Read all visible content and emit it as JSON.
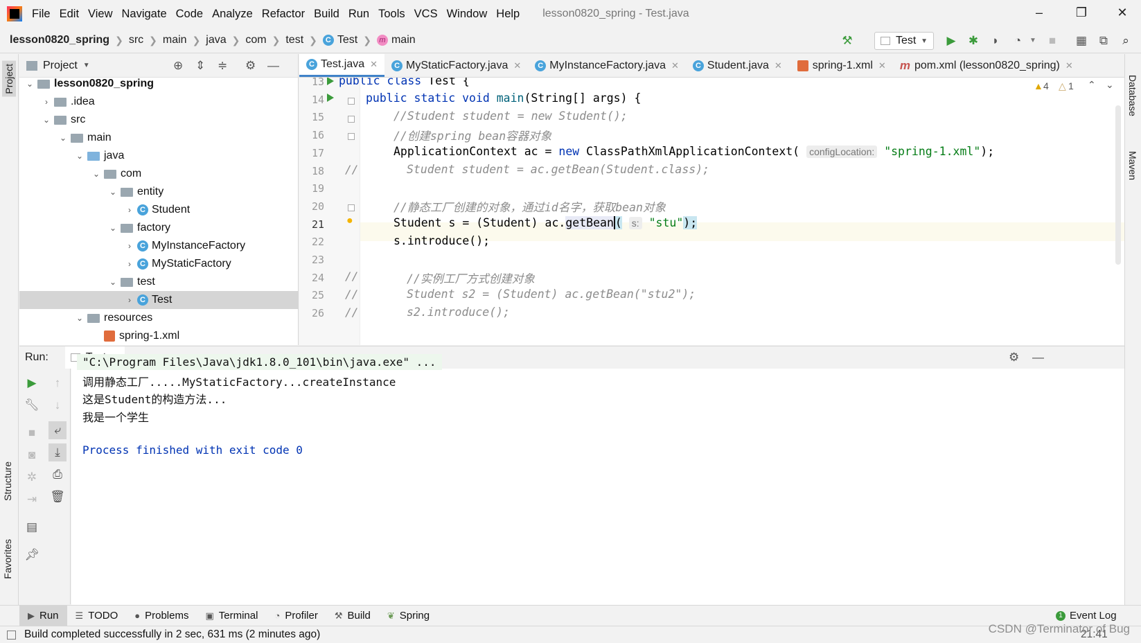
{
  "menubar": {
    "items": [
      "File",
      "Edit",
      "View",
      "Navigate",
      "Code",
      "Analyze",
      "Refactor",
      "Build",
      "Run",
      "Tools",
      "VCS",
      "Window",
      "Help"
    ],
    "window_title": "lesson0820_spring - Test.java",
    "controls": {
      "minimize": "–",
      "restore": "❐",
      "close": "✕"
    }
  },
  "breadcrumb": [
    "lesson0820_spring",
    "src",
    "main",
    "java",
    "com",
    "test",
    "Test",
    "main"
  ],
  "toolbar": {
    "run_config": "Test"
  },
  "project_panel": {
    "title": "Project",
    "tree": [
      {
        "label": "lesson0820_spring",
        "depth": 0,
        "expanded": true,
        "type": "module"
      },
      {
        "label": ".idea",
        "depth": 1,
        "expanded": false,
        "type": "folder"
      },
      {
        "label": "src",
        "depth": 1,
        "expanded": true,
        "type": "folder"
      },
      {
        "label": "main",
        "depth": 2,
        "expanded": true,
        "type": "folder"
      },
      {
        "label": "java",
        "depth": 3,
        "expanded": true,
        "type": "source-folder"
      },
      {
        "label": "com",
        "depth": 4,
        "expanded": true,
        "type": "package"
      },
      {
        "label": "entity",
        "depth": 5,
        "expanded": true,
        "type": "package"
      },
      {
        "label": "Student",
        "depth": 6,
        "expanded": false,
        "type": "class"
      },
      {
        "label": "factory",
        "depth": 5,
        "expanded": true,
        "type": "package"
      },
      {
        "label": "MyInstanceFactory",
        "depth": 6,
        "expanded": false,
        "type": "class"
      },
      {
        "label": "MyStaticFactory",
        "depth": 6,
        "expanded": false,
        "type": "class"
      },
      {
        "label": "test",
        "depth": 5,
        "expanded": true,
        "type": "package"
      },
      {
        "label": "Test",
        "depth": 6,
        "expanded": false,
        "type": "class",
        "selected": true
      },
      {
        "label": "resources",
        "depth": 3,
        "expanded": true,
        "type": "resources"
      },
      {
        "label": "spring-1.xml",
        "depth": 4,
        "expanded": false,
        "type": "xml"
      }
    ]
  },
  "editor_tabs": [
    {
      "label": "Test.java",
      "icon": "class-icon",
      "active": true
    },
    {
      "label": "MyStaticFactory.java",
      "icon": "class-icon",
      "active": false
    },
    {
      "label": "MyInstanceFactory.java",
      "icon": "class-icon",
      "active": false
    },
    {
      "label": "Student.java",
      "icon": "class-icon",
      "active": false
    },
    {
      "label": "spring-1.xml",
      "icon": "xml-icon",
      "active": false
    },
    {
      "label": "pom.xml (lesson0820_spring)",
      "icon": "maven-icon",
      "active": false
    }
  ],
  "inspections": {
    "warnings": "4",
    "weak_warnings": "1"
  },
  "code": {
    "line_numbers": [
      "13",
      "14",
      "15",
      "16",
      "17",
      "18",
      "19",
      "20",
      "21",
      "22",
      "23",
      "24",
      "25",
      "26"
    ],
    "l13_kw": "public class ",
    "l13_rest": "Test {",
    "l14_kw": "public static void ",
    "l14_name": "main",
    "l14_rest": "(String[] args) {",
    "l15": "//Student student = new Student();",
    "l16": "//创建spring bean容器对象",
    "l17_a": "ApplicationContext ac = ",
    "l17_kw": "new ",
    "l17_b": "ClassPathXmlApplicationContext(",
    "l17_hint": "configLocation:",
    "l17_str": "\"spring-1.xml\"",
    "l17_end": ");",
    "l18_gutter": "//",
    "l18": "Student student = ac.getBean(Student.class);",
    "l20": "//静态工厂创建的对象，通过id名字，获取bean对象",
    "l21_a": "Student s = (Student) ac.",
    "l21_method": "getBean",
    "l21_paren": "(",
    "l21_hint": "s:",
    "l21_str": "\"stu\"",
    "l21_end": ");",
    "l22": "s.introduce();",
    "l24_gutter": "//",
    "l24": "//实例工厂方式创建对象",
    "l25_gutter": "//",
    "l25": "Student s2 = (Student) ac.getBean(\"stu2\");",
    "l26_gutter": "//",
    "l26": "s2.introduce();"
  },
  "run_panel": {
    "label": "Run:",
    "tab": "Test",
    "console": [
      "\"C:\\Program Files\\Java\\jdk1.8.0_101\\bin\\java.exe\" ...",
      "调用静态工厂.....MyStaticFactory...createInstance",
      "这是Student的构造方法...",
      "我是一个学生",
      "Process finished with exit code 0"
    ]
  },
  "bottom_tabs": [
    {
      "label": "Run",
      "icon": "run-icon",
      "active": true
    },
    {
      "label": "TODO",
      "icon": "todo-icon",
      "active": false
    },
    {
      "label": "Problems",
      "icon": "problems-icon",
      "active": false
    },
    {
      "label": "Terminal",
      "icon": "terminal-icon",
      "active": false
    },
    {
      "label": "Profiler",
      "icon": "profiler-icon",
      "active": false
    },
    {
      "label": "Build",
      "icon": "hammer-icon",
      "active": false
    },
    {
      "label": "Spring",
      "icon": "spring-icon",
      "active": false
    }
  ],
  "event_log": "Event Log",
  "status": {
    "message": "Build completed successfully in 2 sec, 631 ms (2 minutes ago)",
    "position": "21:41"
  },
  "side_tabs": {
    "project": "Project",
    "structure": "Structure",
    "favorites": "Favorites",
    "database": "Database",
    "maven": "Maven"
  },
  "watermark": "CSDN @Terminator of Bug",
  "colors": {
    "keyword": "#0033b3",
    "comment": "#8c8c8c",
    "string": "#067d17",
    "accent": "#4083c9",
    "run_green": "#3b9b3b"
  }
}
